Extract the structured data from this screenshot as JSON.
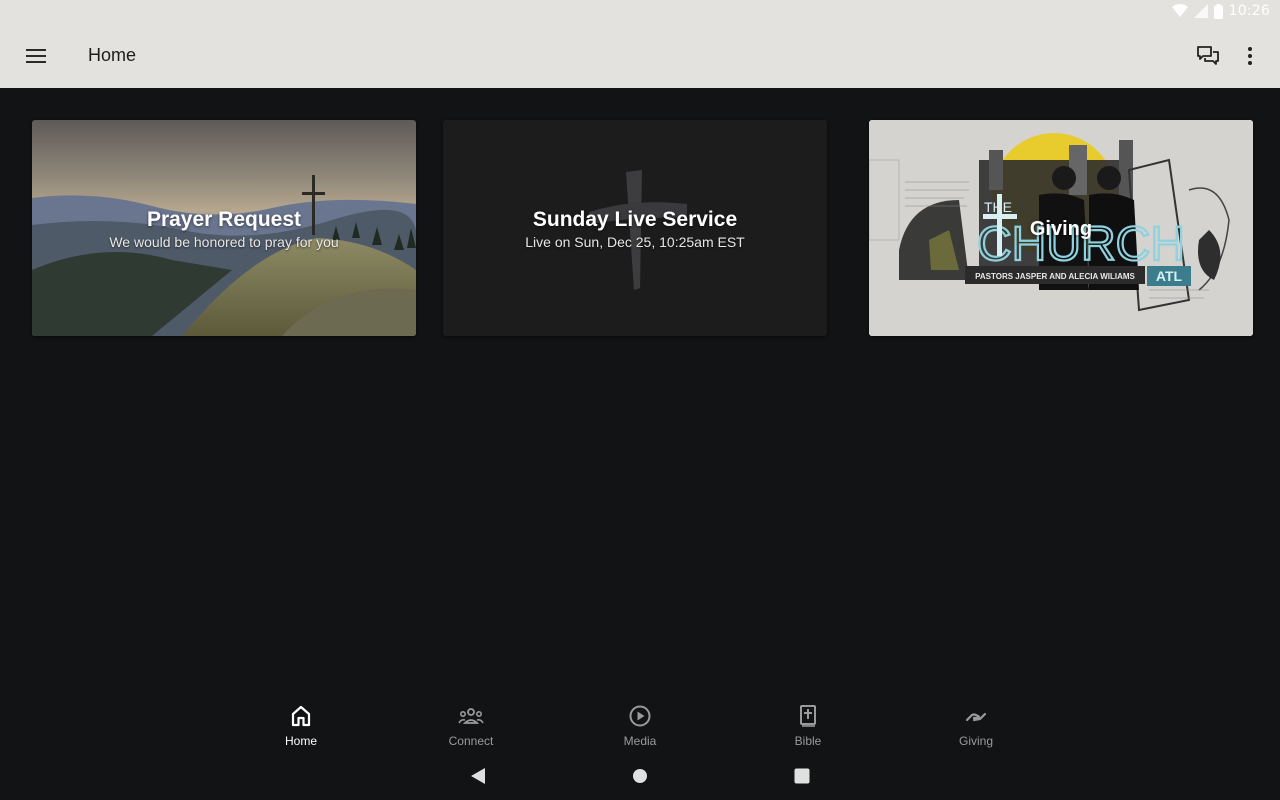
{
  "status_bar": {
    "time": "10:26",
    "icons": [
      "wifi-icon",
      "signal-icon",
      "battery-icon"
    ]
  },
  "app_bar": {
    "title": "Home",
    "icons": [
      "menu-icon",
      "chat-icon",
      "more-vert-icon"
    ],
    "background": "#e3e2de"
  },
  "cards": [
    {
      "title": "Prayer Request",
      "subtitle": "We would be honored to pray for you"
    },
    {
      "title": "Sunday Live Service",
      "subtitle": "Live on Sun, Dec 25, 10:25am EST"
    },
    {
      "title": "Giving",
      "art_text": {
        "the": "THE",
        "church": "CHURCH",
        "pastors": "PASTORS JASPER AND ALECIA WILIAMS",
        "atl": "ATL"
      }
    }
  ],
  "bottom_nav": {
    "items": [
      {
        "label": "Home",
        "icon": "home-icon",
        "active": true
      },
      {
        "label": "Connect",
        "icon": "groups-icon",
        "active": false
      },
      {
        "label": "Media",
        "icon": "play-circle-icon",
        "active": false
      },
      {
        "label": "Bible",
        "icon": "bible-icon",
        "active": false
      },
      {
        "label": "Giving",
        "icon": "giving-hand-icon",
        "active": false
      }
    ]
  },
  "system_nav": {
    "icons": [
      "back-icon",
      "home-circle-icon",
      "recents-icon"
    ]
  },
  "colors": {
    "background": "#121315",
    "active": "#ffffff",
    "inactive": "#9a9a9a"
  }
}
